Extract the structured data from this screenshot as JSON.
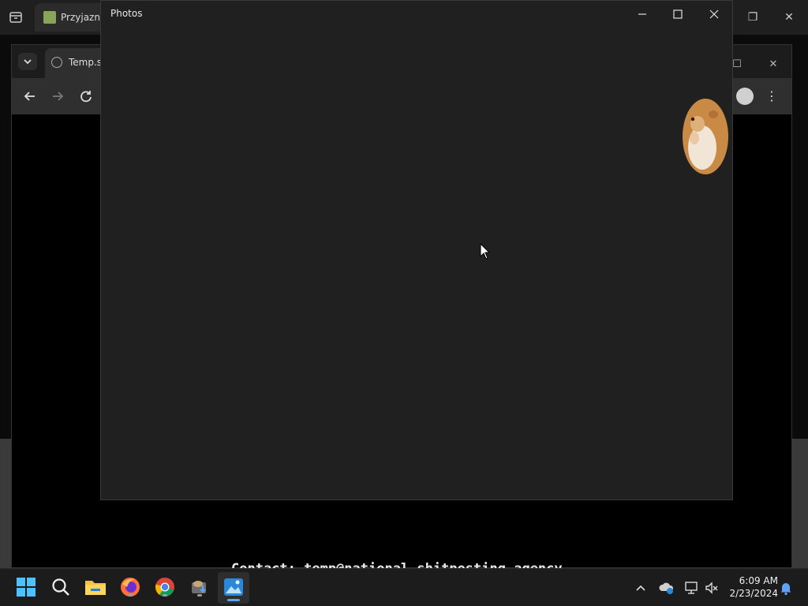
{
  "back_browser": {
    "tab_title": "Przyjazny"
  },
  "browser": {
    "tab_title": "Temp.sh",
    "contact_text": "Contact: temp@national-shitposting.agency"
  },
  "photos": {
    "title": "Photos",
    "image": "hamster-image"
  },
  "taskbar": {
    "items": [
      "start-icon",
      "search-icon",
      "file-explorer-icon",
      "firefox-icon",
      "chrome-icon",
      "app-icon",
      "photos-icon"
    ],
    "time": "6:09 AM",
    "date": "2/23/2024"
  },
  "colors": {
    "accent": "#5ea3f5",
    "window_bg": "#202020"
  }
}
